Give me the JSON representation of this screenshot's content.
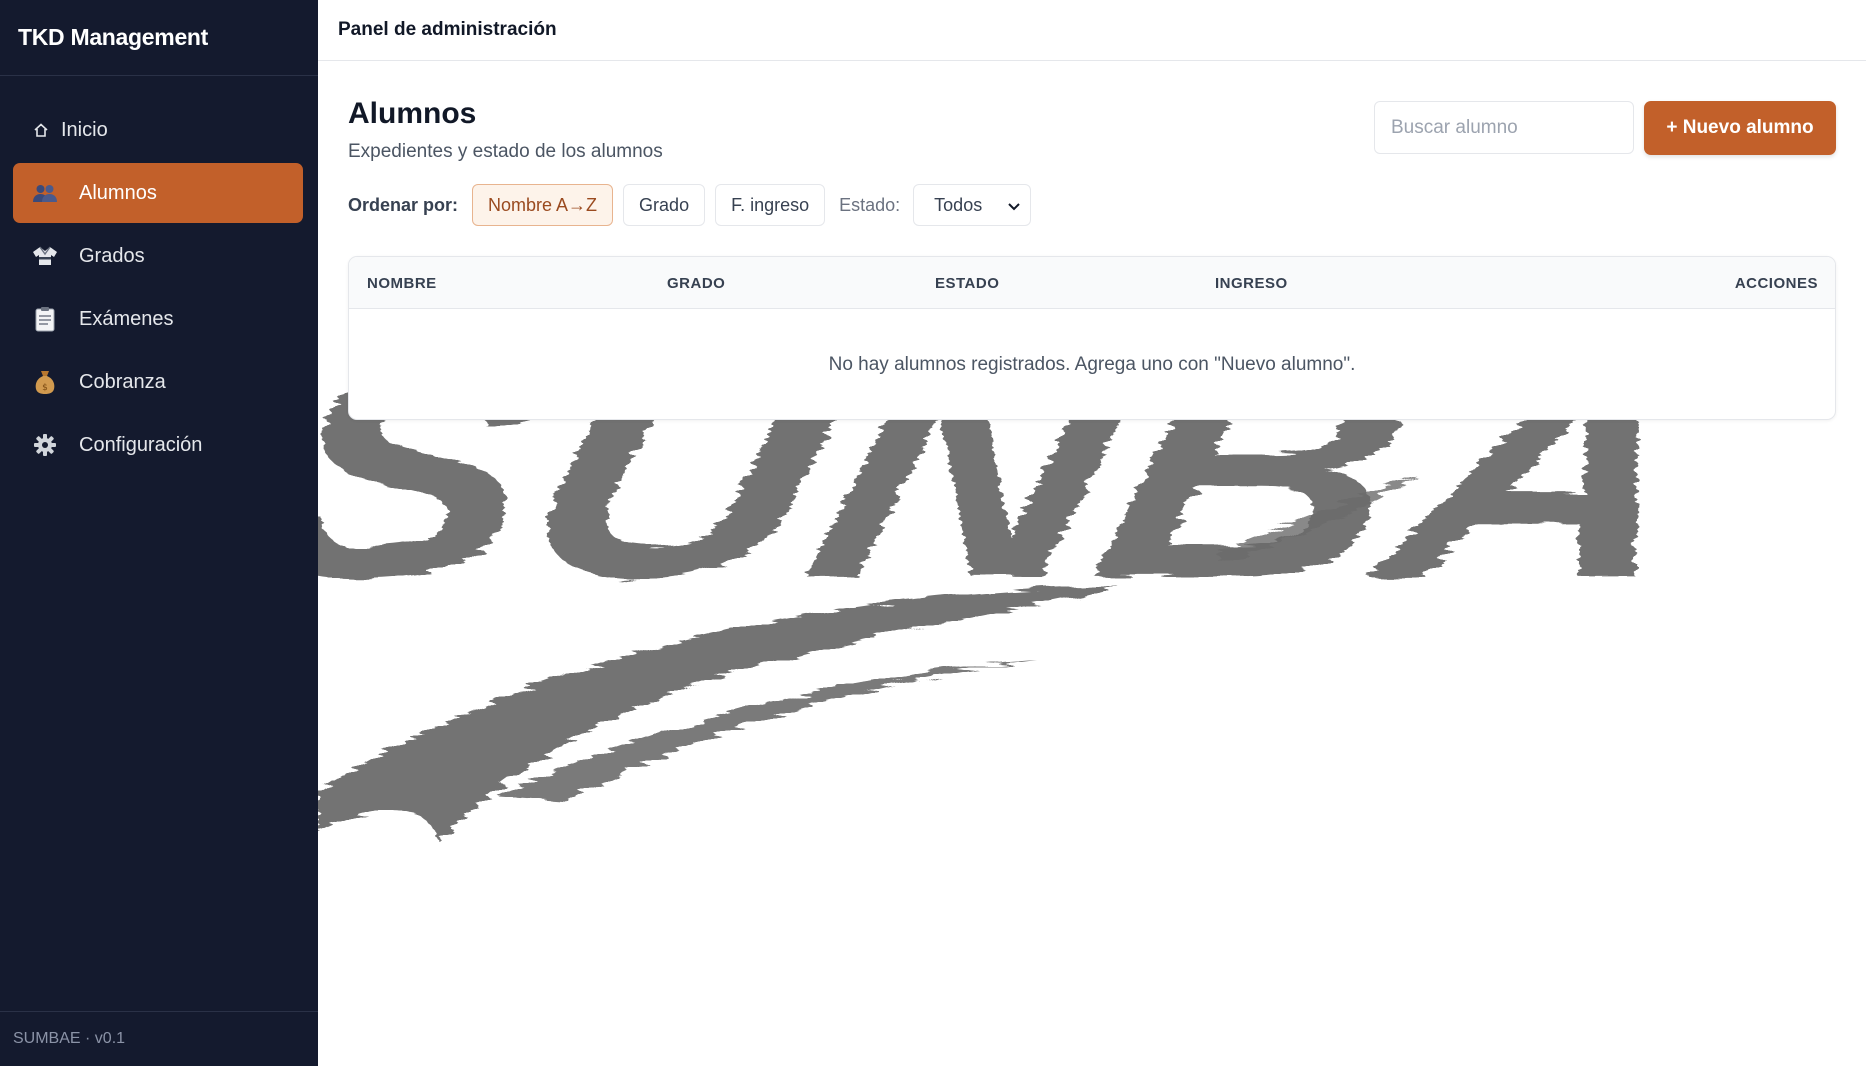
{
  "app": {
    "title": "TKD Management",
    "version": "SUMBAE · v0.1"
  },
  "sidebar": {
    "items": [
      {
        "label": "Inicio",
        "icon": "home-icon"
      },
      {
        "label": "Alumnos",
        "icon": "people-icon",
        "active": true
      },
      {
        "label": "Grados",
        "icon": "uniform-icon"
      },
      {
        "label": "Exámenes",
        "icon": "clipboard-icon"
      },
      {
        "label": "Cobranza",
        "icon": "money-bag-icon"
      },
      {
        "label": "Configuración",
        "icon": "gear-icon"
      }
    ]
  },
  "header": {
    "title": "Panel de administración"
  },
  "page": {
    "title": "Alumnos",
    "subtitle": "Expedientes y estado de los alumnos",
    "search_placeholder": "Buscar alumno",
    "new_button": "+ Nuevo alumno"
  },
  "sort": {
    "label": "Ordenar por:",
    "options": [
      "Nombre A→Z",
      "Grado",
      "F. ingreso"
    ],
    "active": "Nombre A→Z",
    "estado_label": "Estado:",
    "estado_value": "Todos"
  },
  "table": {
    "columns": [
      "NOMBRE",
      "GRADO",
      "ESTADO",
      "INGRESO",
      "ACCIONES"
    ],
    "empty_message": "No hay alumnos registrados. Agrega uno con \"Nuevo alumno\"."
  },
  "watermark": {
    "text": "SUNBAE"
  },
  "colors": {
    "sidebar_bg": "#141a2e",
    "accent": "#c2602a",
    "watermark": "#6b6b6b"
  }
}
